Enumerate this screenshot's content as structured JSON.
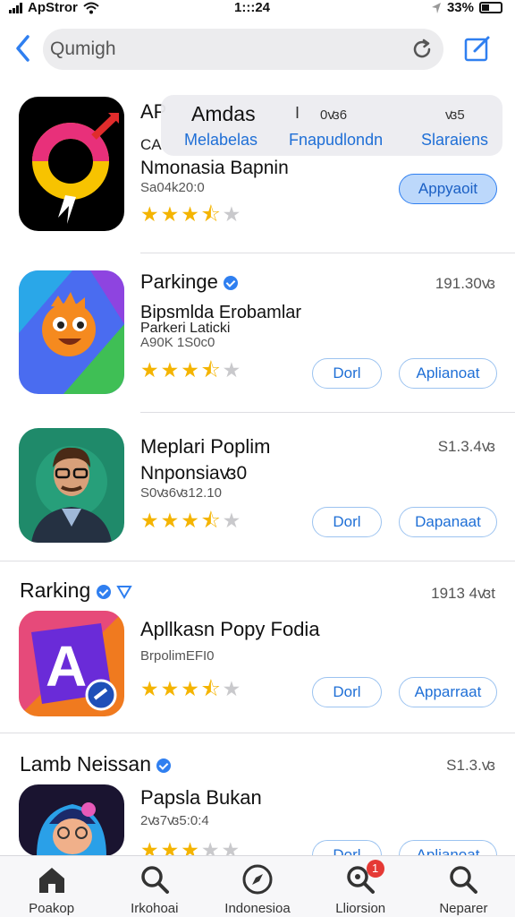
{
  "status_bar": {
    "carrier": "ApStror",
    "time": "1:::24",
    "battery": "33%"
  },
  "search": {
    "value": "Qumigh"
  },
  "dropdown": {
    "title": "Amdas",
    "separator": "I",
    "code_left": "0ꟃ6",
    "code_right": "ꟃ5",
    "options": [
      "Melabelas",
      "Fnapudlondn",
      "Slaraiens"
    ]
  },
  "apps": [
    {
      "name": "AP",
      "category_tag": "CA",
      "title": "Nmonasia Bapnin",
      "meta": "Sa04k20:0",
      "rating": 3.5,
      "primary_button": "Appyaoit"
    },
    {
      "name": "Parkinge",
      "description": "Bipsmlda Erobamlar",
      "description2": "Parkeri Laticki",
      "meta": "A90K 1S0c0",
      "price": "191.30ꟃ",
      "rating": 3.5,
      "button1": "Dorl",
      "button2": "Aplianoat"
    },
    {
      "name": "Meplari Poplim",
      "subtitle": "Nnponsiaꟃ0",
      "meta": "S0ꟃ6ꟃ12.10",
      "price": "S1.3.4ꟃ",
      "rating": 3.5,
      "button1": "Dorl",
      "button2": "Dapanaat"
    },
    {
      "section": "Rarking",
      "name": "Apllkasn Popy Fodia",
      "meta": "BrpolimEFI0",
      "price": "1913 4ꟃt",
      "rating": 3.5,
      "button1": "Dorl",
      "button2": "Apparraat"
    },
    {
      "section": "Lamb Neissan",
      "name": "Papsla Bukan",
      "meta": "2ꟃ7ꟃ5:0:4",
      "price": "S1.3.ꟃ",
      "rating": 3,
      "button1": "Dorl",
      "button2": "Aplianoat"
    }
  ],
  "tabs": [
    {
      "label": "Poakop",
      "icon": "home-icon"
    },
    {
      "label": "Irkohoai",
      "icon": "search-icon"
    },
    {
      "label": "Indonesioa",
      "icon": "compass-icon"
    },
    {
      "label": "Lliorsion",
      "icon": "updates-search-icon",
      "badge": "1"
    },
    {
      "label": "Neparer",
      "icon": "search-icon"
    }
  ],
  "colors": {
    "accent": "#2f7ff0",
    "star": "#f4b400",
    "badge": "#e53935"
  }
}
